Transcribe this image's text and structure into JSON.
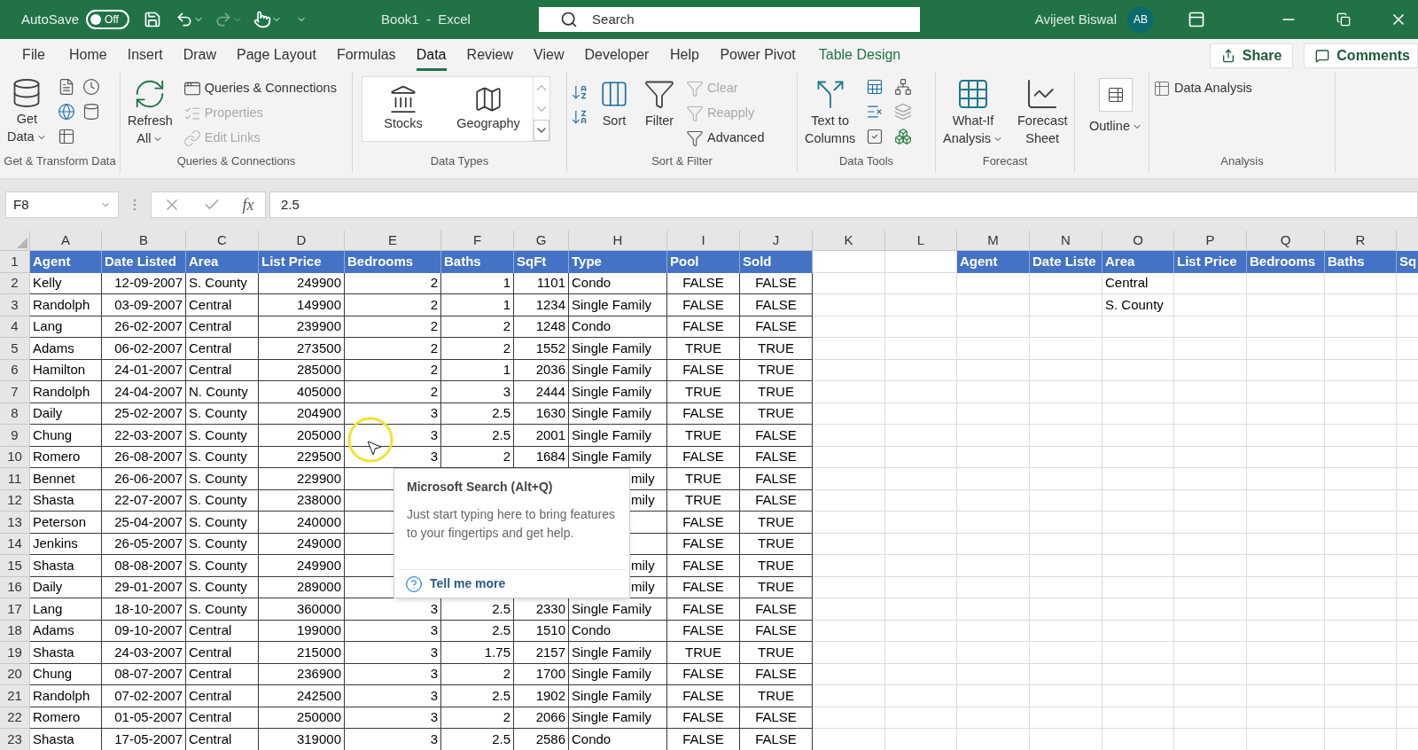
{
  "title_bar": {
    "autosave_label": "AutoSave",
    "autosave_toggle": {
      "label": "Off",
      "on": false
    },
    "title": "Book1  -  Excel",
    "search_placeholder": "Search",
    "user_name": "Avijeet Biswal",
    "avatar_initials": "AB"
  },
  "ribbon_tabs": [
    {
      "label": "File",
      "selected": false,
      "kind": "normal"
    },
    {
      "label": "Home",
      "selected": false,
      "kind": "normal"
    },
    {
      "label": "Insert",
      "selected": false,
      "kind": "normal"
    },
    {
      "label": "Draw",
      "selected": false,
      "kind": "normal"
    },
    {
      "label": "Page Layout",
      "selected": false,
      "kind": "normal"
    },
    {
      "label": "Formulas",
      "selected": false,
      "kind": "normal"
    },
    {
      "label": "Data",
      "selected": true,
      "kind": "normal"
    },
    {
      "label": "Review",
      "selected": false,
      "kind": "normal"
    },
    {
      "label": "View",
      "selected": false,
      "kind": "normal"
    },
    {
      "label": "Developer",
      "selected": false,
      "kind": "normal"
    },
    {
      "label": "Help",
      "selected": false,
      "kind": "normal"
    },
    {
      "label": "Power Pivot",
      "selected": false,
      "kind": "normal"
    },
    {
      "label": "Table Design",
      "selected": false,
      "kind": "contextual"
    }
  ],
  "share_button": "Share",
  "comments_button": "Comments",
  "ribbon_groups": [
    {
      "label": "Get & Transform Data",
      "buttons": [
        {
          "lines": [
            "Get",
            "Data"
          ],
          "dropdown": true,
          "disabled": false
        }
      ]
    },
    {
      "label": "Queries & Connections",
      "buttons": [
        {
          "lines": [
            "Refresh",
            "All"
          ],
          "dropdown": true,
          "disabled": false
        },
        {
          "lines": [
            "Queries & Connections"
          ],
          "dropdown": false,
          "disabled": false
        },
        {
          "lines": [
            "Properties"
          ],
          "dropdown": false,
          "disabled": true
        },
        {
          "lines": [
            "Edit Links"
          ],
          "dropdown": false,
          "disabled": true
        }
      ]
    },
    {
      "label": "Data Types",
      "buttons": [
        {
          "lines": [
            "Stocks"
          ],
          "dropdown": false,
          "disabled": false
        },
        {
          "lines": [
            "Geography"
          ],
          "dropdown": false,
          "disabled": false
        }
      ]
    },
    {
      "label": "Sort & Filter",
      "buttons": [
        {
          "lines": [
            "Sort"
          ],
          "dropdown": false,
          "disabled": false
        },
        {
          "lines": [
            "Filter"
          ],
          "dropdown": false,
          "disabled": false
        },
        {
          "lines": [
            "Clear"
          ],
          "dropdown": false,
          "disabled": true
        },
        {
          "lines": [
            "Reapply"
          ],
          "dropdown": false,
          "disabled": true
        },
        {
          "lines": [
            "Advanced"
          ],
          "dropdown": false,
          "disabled": false
        }
      ]
    },
    {
      "label": "Data Tools",
      "buttons": [
        {
          "lines": [
            "Text to",
            "Columns"
          ],
          "dropdown": false,
          "disabled": false
        }
      ]
    },
    {
      "label": "Forecast",
      "buttons": [
        {
          "lines": [
            "What-If",
            "Analysis"
          ],
          "dropdown": true,
          "disabled": false
        },
        {
          "lines": [
            "Forecast",
            "Sheet"
          ],
          "dropdown": false,
          "disabled": false
        }
      ]
    },
    {
      "buttons": [
        {
          "lines": [
            "Outline"
          ],
          "dropdown": true,
          "disabled": false
        }
      ]
    },
    {
      "label": "Analysis",
      "buttons": [
        {
          "lines": [
            "Data Analysis"
          ],
          "dropdown": false,
          "disabled": false
        }
      ]
    }
  ],
  "formula_bar": {
    "name_box": "F8",
    "function_label": "fx",
    "value": "2.5"
  },
  "sheet": {
    "columns": [
      "A",
      "B",
      "C",
      "D",
      "E",
      "F",
      "G",
      "H",
      "I",
      "J",
      "K",
      "L",
      "M",
      "N",
      "O",
      "P",
      "Q",
      "R"
    ],
    "rows": [
      {
        "number": "1",
        "kind": "header",
        "cells": [
          "Agent",
          "Date Listed",
          "Area",
          "List Price",
          "Bedrooms",
          "Baths",
          "SqFt",
          "Type",
          "Pool",
          "Sold",
          null,
          null,
          "Agent",
          "Date Liste",
          "Area",
          "List Price",
          "Bedrooms",
          "Baths",
          "Sq"
        ]
      },
      {
        "number": "2",
        "kind": "data",
        "cells": [
          "Kelly",
          "12-09-2007",
          "S. County",
          "249900",
          "2",
          "1",
          "1101",
          "Condo",
          "FALSE",
          "FALSE",
          null,
          null,
          null,
          null,
          "Central"
        ]
      },
      {
        "number": "3",
        "kind": "data",
        "cells": [
          "Randolph",
          "03-09-2007",
          "Central",
          "149900",
          "2",
          "1",
          "1234",
          "Single Family",
          "FALSE",
          "FALSE",
          null,
          null,
          null,
          null,
          "S. County"
        ]
      },
      {
        "number": "4",
        "kind": "data",
        "cells": [
          "Lang",
          "26-02-2007",
          "Central",
          "239900",
          "2",
          "2",
          "1248",
          "Condo",
          "FALSE",
          "FALSE"
        ]
      },
      {
        "number": "5",
        "kind": "data",
        "cells": [
          "Adams",
          "06-02-2007",
          "Central",
          "273500",
          "2",
          "2",
          "1552",
          "Single Family",
          "TRUE",
          "TRUE"
        ]
      },
      {
        "number": "6",
        "kind": "data",
        "cells": [
          "Hamilton",
          "24-01-2007",
          "Central",
          "285000",
          "2",
          "1",
          "2036",
          "Single Family",
          "FALSE",
          "TRUE"
        ]
      },
      {
        "number": "7",
        "kind": "data",
        "cells": [
          "Randolph",
          "24-04-2007",
          "N. County",
          "405000",
          "2",
          "3",
          "2444",
          "Single Family",
          "TRUE",
          "TRUE"
        ]
      },
      {
        "number": "8",
        "kind": "data",
        "cells": [
          "Daily",
          "25-02-2007",
          "S. County",
          "204900",
          "3",
          "2.5",
          "1630",
          "Single Family",
          "FALSE",
          "TRUE"
        ]
      },
      {
        "number": "9",
        "kind": "data",
        "cells": [
          "Chung",
          "22-03-2007",
          "S. County",
          "205000",
          "3",
          "2.5",
          "2001",
          "Single Family",
          "TRUE",
          "FALSE"
        ]
      },
      {
        "number": "10",
        "kind": "data",
        "cells": [
          "Romero",
          "26-08-2007",
          "S. County",
          "229500",
          "3",
          "2",
          "1684",
          "Single Family",
          "FALSE",
          "FALSE"
        ]
      },
      {
        "number": "11",
        "kind": "data",
        "cells": [
          "Bennet",
          "26-06-2007",
          "S. County",
          "229900",
          null,
          null,
          null,
          {
            "text": "mily",
            "clipped": true
          },
          "TRUE",
          "FALSE"
        ]
      },
      {
        "number": "12",
        "kind": "data",
        "cells": [
          "Shasta",
          "22-07-2007",
          "S. County",
          "238000",
          null,
          null,
          null,
          {
            "text": "mily",
            "clipped": true
          },
          "TRUE",
          "FALSE"
        ]
      },
      {
        "number": "13",
        "kind": "data",
        "cells": [
          "Peterson",
          "25-04-2007",
          "S. County",
          "240000",
          null,
          null,
          null,
          null,
          "FALSE",
          "TRUE"
        ]
      },
      {
        "number": "14",
        "kind": "data",
        "cells": [
          "Jenkins",
          "26-05-2007",
          "S. County",
          "249000",
          null,
          null,
          null,
          null,
          "FALSE",
          "TRUE"
        ]
      },
      {
        "number": "15",
        "kind": "data",
        "cells": [
          "Shasta",
          "08-08-2007",
          "S. County",
          "249900",
          null,
          null,
          null,
          {
            "text": "mily",
            "clipped": true
          },
          "FALSE",
          "TRUE"
        ]
      },
      {
        "number": "16",
        "kind": "data",
        "cells": [
          "Daily",
          "29-01-2007",
          "S. County",
          "289000",
          null,
          null,
          null,
          {
            "text": "mily",
            "clipped": true
          },
          "FALSE",
          "TRUE"
        ]
      },
      {
        "number": "17",
        "kind": "data",
        "cells": [
          "Lang",
          "18-10-2007",
          "S. County",
          "360000",
          "3",
          "2.5",
          "2330",
          "Single Family",
          "FALSE",
          "FALSE"
        ]
      },
      {
        "number": "18",
        "kind": "data",
        "cells": [
          "Adams",
          "09-10-2007",
          "Central",
          "199000",
          "3",
          "2.5",
          "1510",
          "Condo",
          "FALSE",
          "FALSE"
        ]
      },
      {
        "number": "19",
        "kind": "data",
        "cells": [
          "Shasta",
          "24-03-2007",
          "Central",
          "215000",
          "3",
          "1.75",
          "2157",
          "Single Family",
          "TRUE",
          "TRUE"
        ]
      },
      {
        "number": "20",
        "kind": "data",
        "cells": [
          "Chung",
          "08-07-2007",
          "Central",
          "236900",
          "3",
          "2",
          "1700",
          "Single Family",
          "FALSE",
          "FALSE"
        ]
      },
      {
        "number": "21",
        "kind": "data",
        "cells": [
          "Randolph",
          "07-02-2007",
          "Central",
          "242500",
          "3",
          "2.5",
          "1902",
          "Single Family",
          "FALSE",
          "TRUE"
        ]
      },
      {
        "number": "22",
        "kind": "data",
        "cells": [
          "Romero",
          "01-05-2007",
          "Central",
          "250000",
          "3",
          "2",
          "2066",
          "Single Family",
          "FALSE",
          "FALSE"
        ]
      },
      {
        "number": "23",
        "kind": "data",
        "cells": [
          "Shasta",
          "17-05-2007",
          "Central",
          "319000",
          "3",
          "2.5",
          "2586",
          "Condo",
          "FALSE",
          "FALSE"
        ]
      }
    ]
  },
  "tooltip": {
    "title": "Microsoft Search (Alt+Q)",
    "body": "Just start typing here to bring features to your fingertips and get help.",
    "link": "Tell me more"
  }
}
